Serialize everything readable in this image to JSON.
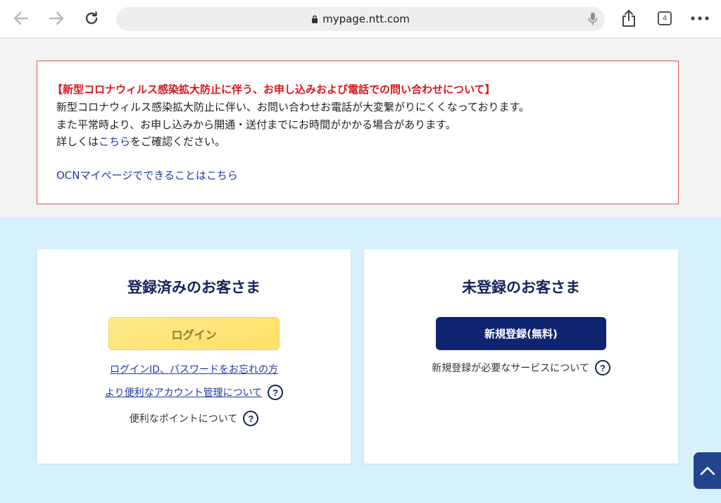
{
  "browser": {
    "url": "mypage.ntt.com",
    "tab_count": "4"
  },
  "notice": {
    "title": "【新型コロナウィルス感染拡大防止に伴う、お申し込みおよび電話での問い合わせについて】",
    "line1": "新型コロナウィルス感染拡大防止に伴い、お問い合わせお電話が大変繋がりにくくなっております。",
    "line2": "また平常時より、お申し込みから開通・送付までにお時間がかかる場合があります。",
    "line3_prefix": "詳しくは",
    "line3_link": "こちら",
    "line3_suffix": "をご確認ください。",
    "ocn_link": "OCNマイページでできることはこちら"
  },
  "registered": {
    "heading": "登録済みのお客さま",
    "login_button": "ログイン",
    "forgot_link": "ログインID、パスワードをお忘れの方",
    "account_link": "より便利なアカウント管理について",
    "points_text": "便利なポイントについて"
  },
  "unregistered": {
    "heading": "未登録のお客さま",
    "signup_button": "新規登録(無料)",
    "services_text": "新規登録が必要なサービスについて"
  },
  "help_glyph": "?",
  "colors": {
    "notice_title": "#d8171d",
    "link": "#1f3aa5",
    "navy": "#0f2470",
    "login_yellow": "#ffe067",
    "lower_bg": "#d6f1fb"
  }
}
